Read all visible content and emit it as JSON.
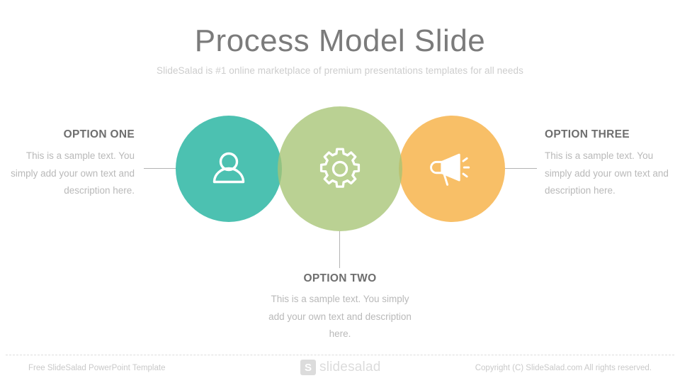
{
  "header": {
    "title": "Process Model Slide",
    "subtitle": "SlideSalad is #1 online marketplace of premium presentations templates for all needs"
  },
  "colors": {
    "circle_one": "#4cc1b1",
    "circle_two": "#a7c475",
    "circle_three": "#f8bf67",
    "heading_text": "#6e6e6e",
    "body_text": "#b9b9b9",
    "title_text": "#7b7b7b",
    "subtitle_text": "#cdcdcd",
    "connector_line": "#b4b4b4",
    "footer_text": "#c9c9c9",
    "logo": "#dcdcdc"
  },
  "options": [
    {
      "id": "one",
      "heading": "OPTION ONE",
      "body": "This is a sample text. You simply add your own text and description here.",
      "icon": "person-icon",
      "color": "#4cc1b1",
      "align": "right"
    },
    {
      "id": "two",
      "heading": "OPTION TWO",
      "body": "This is a sample text. You simply add your own text and description here.",
      "icon": "gear-icon",
      "color": "#a7c475",
      "align": "center"
    },
    {
      "id": "three",
      "heading": "OPTION THREE",
      "body": "This is a sample text. You simply add your own text and description here.",
      "icon": "megaphone-icon",
      "color": "#f8bf67",
      "align": "left"
    }
  ],
  "footer": {
    "left": "Free SlideSalad PowerPoint Template",
    "right": "Copyright (C) SlideSalad.com All rights reserved.",
    "logo_mark": "S",
    "logo_word": "slidesalad"
  }
}
